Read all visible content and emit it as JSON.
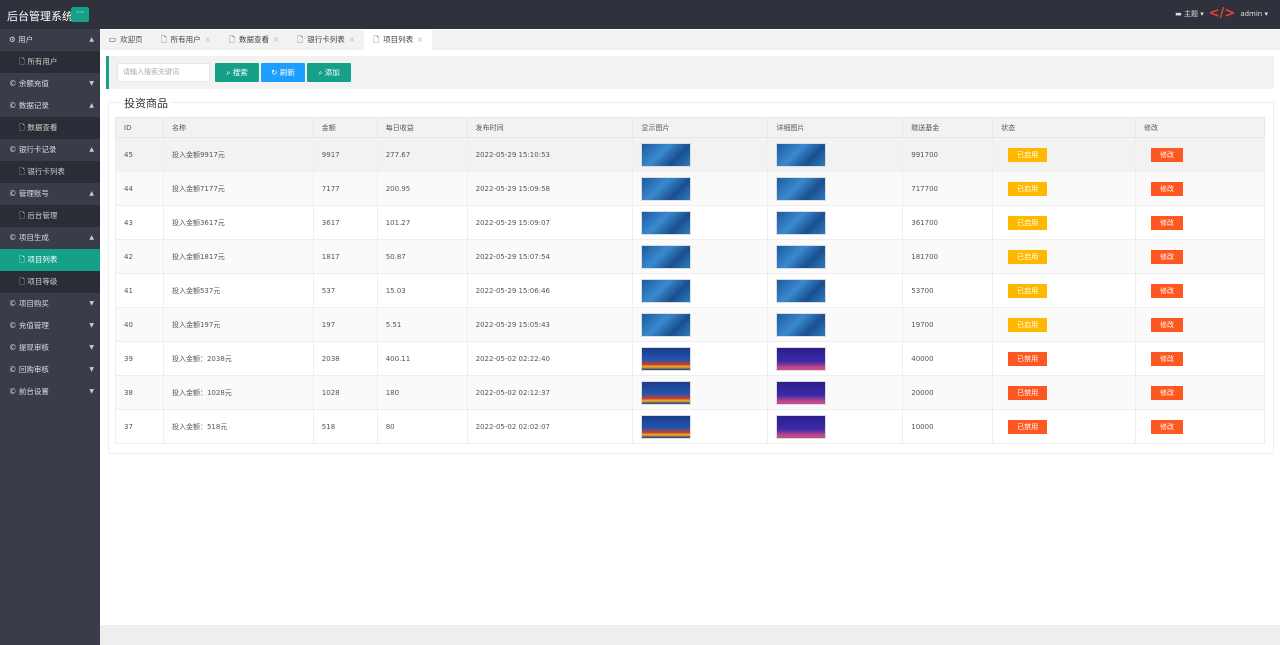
{
  "app": {
    "title": "后台管理系统",
    "menu_button": "···",
    "theme": "主题",
    "user": "admin"
  },
  "sidebar": [
    {
      "label": "用户",
      "open": true,
      "subs": [
        "所有用户"
      ]
    },
    {
      "label": "余额充值",
      "open": false,
      "subs": []
    },
    {
      "label": "数据记录",
      "open": true,
      "subs": [
        "数据查看"
      ]
    },
    {
      "label": "银行卡记录",
      "open": true,
      "subs": [
        "银行卡列表"
      ]
    },
    {
      "label": "管理账号",
      "open": true,
      "subs": [
        "后台管理"
      ]
    },
    {
      "label": "项目生成",
      "open": true,
      "subs": [
        "项目列表",
        "项目等级"
      ]
    },
    {
      "label": "项目购买",
      "open": false,
      "subs": []
    },
    {
      "label": "充值管理",
      "open": false,
      "subs": []
    },
    {
      "label": "提现审核",
      "open": false,
      "subs": []
    },
    {
      "label": "回购审核",
      "open": false,
      "subs": []
    },
    {
      "label": "前台设置",
      "open": false,
      "subs": []
    }
  ],
  "active_sub": "项目列表",
  "tabs": [
    {
      "label": "欢迎页",
      "closable": false
    },
    {
      "label": "所有用户",
      "closable": true
    },
    {
      "label": "数据查看",
      "closable": true
    },
    {
      "label": "银行卡列表",
      "closable": true
    },
    {
      "label": "项目列表",
      "closable": true,
      "active": true
    }
  ],
  "toolbar": {
    "search_placeholder": "请输入搜索关键词",
    "search": "搜索",
    "refresh": "刷新",
    "add": "添加"
  },
  "colors": {
    "accent": "#15a08a",
    "refresh": "#1e9fff",
    "enabled": "#ffb800",
    "disabled": "#ff5722"
  },
  "section_title": "投资商品",
  "table": {
    "headers": [
      "ID",
      "名称",
      "金额",
      "每日收益",
      "发布时间",
      "显示图片",
      "详细图片",
      "赠送基金",
      "状态",
      "修改"
    ],
    "rows": [
      {
        "id": "45",
        "name": "投入金额9917元",
        "amount": "9917",
        "daily": "277.67",
        "time": "2022-05-29 15:10:53",
        "img": "blue",
        "fund": "991700",
        "status": "已启用",
        "state": "on",
        "edit": "修改"
      },
      {
        "id": "44",
        "name": "投入金额7177元",
        "amount": "7177",
        "daily": "200.95",
        "time": "2022-05-29 15:09:58",
        "img": "blue",
        "fund": "717700",
        "status": "已启用",
        "state": "on",
        "edit": "修改"
      },
      {
        "id": "43",
        "name": "投入金额3617元",
        "amount": "3617",
        "daily": "101.27",
        "time": "2022-05-29 15:09:07",
        "img": "blue",
        "fund": "361700",
        "status": "已启用",
        "state": "on",
        "edit": "修改"
      },
      {
        "id": "42",
        "name": "投入金额1817元",
        "amount": "1817",
        "daily": "50.87",
        "time": "2022-05-29 15:07:54",
        "img": "blue",
        "fund": "181700",
        "status": "已启用",
        "state": "on",
        "edit": "修改"
      },
      {
        "id": "41",
        "name": "投入金额537元",
        "amount": "537",
        "daily": "15.03",
        "time": "2022-05-29 15:06:46",
        "img": "blue",
        "fund": "53700",
        "status": "已启用",
        "state": "on",
        "edit": "修改"
      },
      {
        "id": "40",
        "name": "投入金额197元",
        "amount": "197",
        "daily": "5.51",
        "time": "2022-05-29 15:05:43",
        "img": "blue",
        "fund": "19700",
        "status": "已启用",
        "state": "on",
        "edit": "修改"
      },
      {
        "id": "39",
        "name": "投入金额：2038元",
        "amount": "2038",
        "daily": "400.11",
        "time": "2022-05-02 02:22:40",
        "img": "red",
        "fund": "40000",
        "status": "已禁用",
        "state": "off",
        "edit": "修改"
      },
      {
        "id": "38",
        "name": "投入金额：1028元",
        "amount": "1028",
        "daily": "180",
        "time": "2022-05-02 02:12:37",
        "img": "red",
        "fund": "20000",
        "status": "已禁用",
        "state": "off",
        "edit": "修改"
      },
      {
        "id": "37",
        "name": "投入金额：518元",
        "amount": "518",
        "daily": "80",
        "time": "2022-05-02 02:02:07",
        "img": "red",
        "fund": "10000",
        "status": "已禁用",
        "state": "off",
        "edit": "修改"
      }
    ]
  }
}
